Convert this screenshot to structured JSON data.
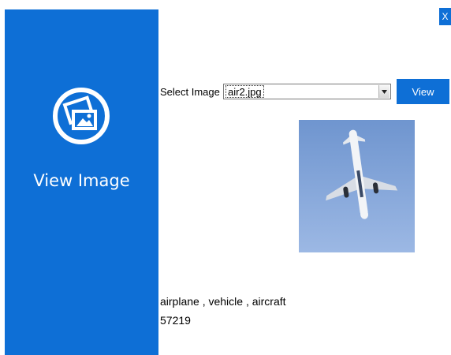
{
  "app": {
    "title": "View Image",
    "close_label": "X",
    "accent_color": "#0e6fd6"
  },
  "form": {
    "select_label": "Select Image",
    "selected_file": "air2.jpg",
    "view_button": "View"
  },
  "result": {
    "tags": "airplane , vehicle , aircraft",
    "number": "57219"
  }
}
